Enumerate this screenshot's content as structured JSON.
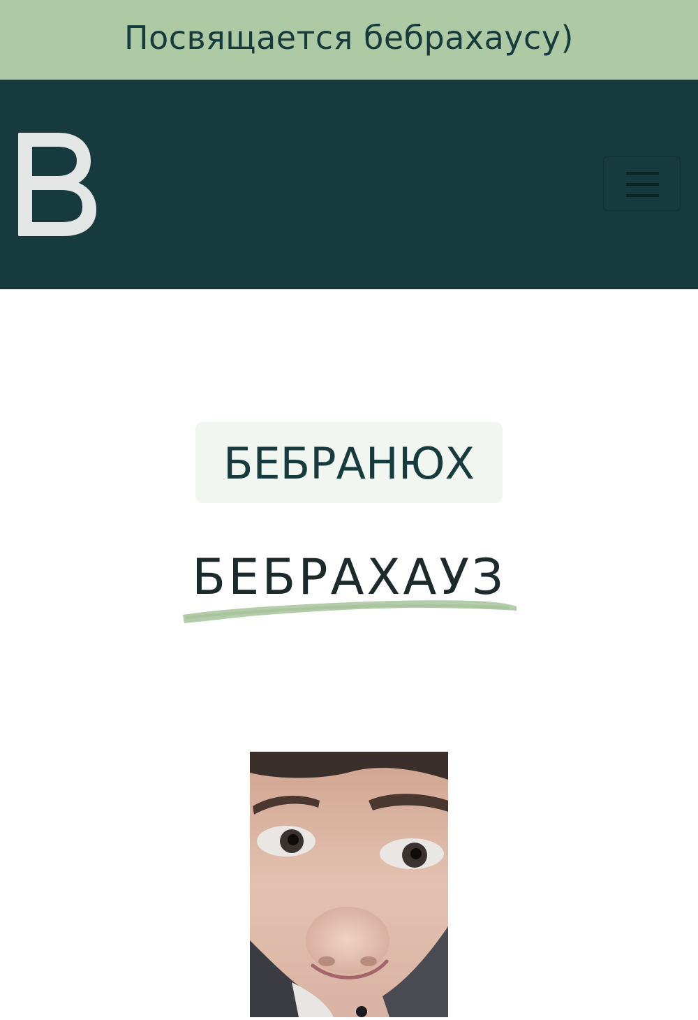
{
  "announcement": {
    "text": "Посвящается бебрахаусу)"
  },
  "navbar": {
    "logo_letter": "B",
    "toggler_icon": "hamburger-menu-icon"
  },
  "hero": {
    "badge_label": "БЕБРАНЮХ",
    "title": "БЕБРАХАУЗ"
  },
  "colors": {
    "announcement_bg": "#aecaa4",
    "navbar_bg": "#163a3d",
    "accent_green": "#aecaa4",
    "badge_bg": "#f1f6f1",
    "dark_text": "#173a3d"
  }
}
